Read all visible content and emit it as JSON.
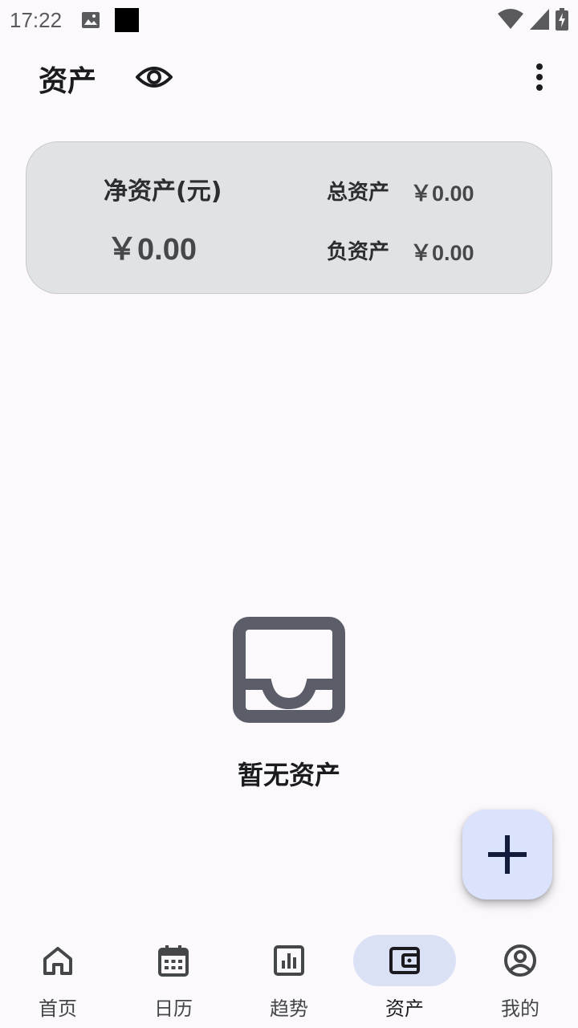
{
  "status_bar": {
    "time": "17:22",
    "icons": [
      "image-icon",
      "square-icon",
      "wifi-icon",
      "signal-icon",
      "battery-charging-icon"
    ]
  },
  "header": {
    "title": "资产",
    "visibility_icon": "eye-icon",
    "menu_icon": "more-vert-icon"
  },
  "summary": {
    "net_label": "净资产(元)",
    "net_value": "￥0.00",
    "total_label": "总资产",
    "total_value": "￥0.00",
    "debt_label": "负资产",
    "debt_value": "￥0.00"
  },
  "empty_state": {
    "icon": "inbox-icon",
    "text": "暂无资产"
  },
  "fab": {
    "icon": "plus-icon"
  },
  "bottom_nav": {
    "items": [
      {
        "label": "首页",
        "icon": "home-icon",
        "active": false
      },
      {
        "label": "日历",
        "icon": "calendar-icon",
        "active": false
      },
      {
        "label": "趋势",
        "icon": "bar-chart-icon",
        "active": false
      },
      {
        "label": "资产",
        "icon": "wallet-icon",
        "active": true
      },
      {
        "label": "我的",
        "icon": "account-circle-icon",
        "active": false
      }
    ]
  },
  "colors": {
    "background": "#fcf9fd",
    "card": "#e1e2e6",
    "fab": "#dbe2fb",
    "nav_active_pill": "#dbe1f4",
    "icon": "#5b5d68"
  }
}
